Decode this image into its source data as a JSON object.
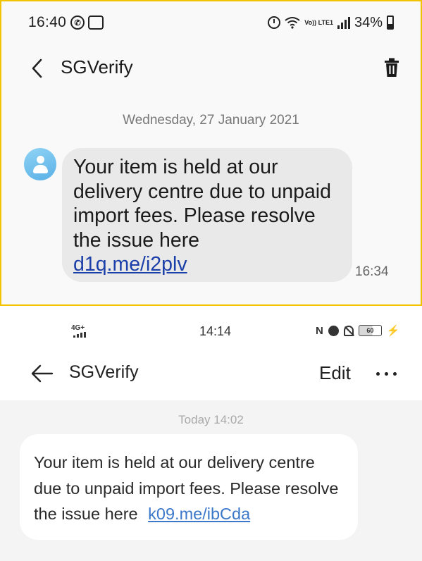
{
  "top": {
    "status_bar": {
      "time": "16:40",
      "network": "Vo)) LTE1",
      "battery": "34%"
    },
    "header": {
      "title": "SGVerify"
    },
    "date_divider": "Wednesday, 27 January 2021",
    "message": {
      "text": "Your item is held at our delivery centre due to unpaid import fees. Please resolve the issue here",
      "link": "d1q.me/i2plv",
      "time": "16:34"
    },
    "icons": [
      "back-arrow-icon",
      "trash-icon",
      "avatar-icon",
      "whatsapp-icon",
      "alarm-icon",
      "wifi-icon",
      "signal-icon",
      "battery-icon"
    ],
    "colors": {
      "background": "#f9f9f9",
      "bubble": "#e9e9e9",
      "link": "#1b3fa8",
      "border": "#f2c300"
    }
  },
  "bottom": {
    "status_bar": {
      "network": "4G+",
      "time": "14:14",
      "battery": "60"
    },
    "header": {
      "title": "SGVerify",
      "edit_label": "Edit"
    },
    "date_divider": "Today 14:02",
    "message": {
      "text": "Your item is held at our delivery centre due to unpaid import fees. Please resolve the issue here",
      "link": "k09.me/ibCda"
    },
    "icons": [
      "back-arrow-icon",
      "more-options-icon",
      "nfc-icon",
      "alarm-icon",
      "mute-icon",
      "battery-icon",
      "charging-icon"
    ],
    "colors": {
      "background": "#ffffff",
      "feed": "#f4f4f4",
      "bubble": "#ffffff",
      "link": "#3b78c9"
    }
  }
}
